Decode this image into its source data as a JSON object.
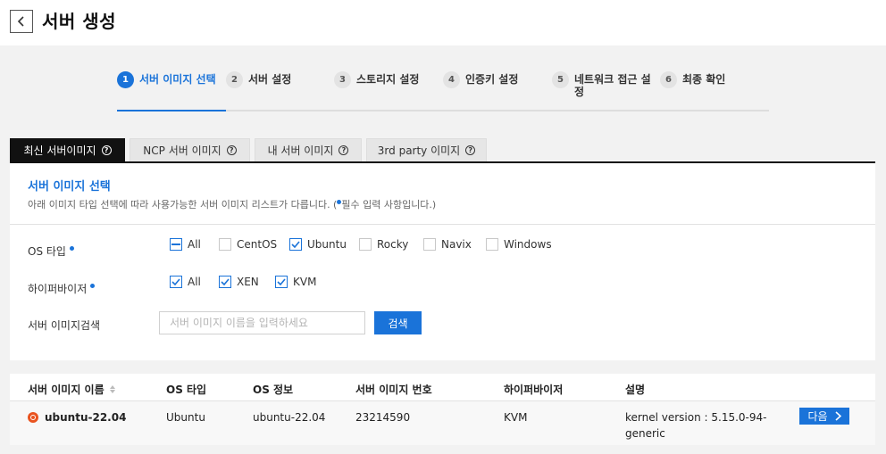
{
  "header": {
    "title": "서버 생성"
  },
  "steps": [
    {
      "num": "1",
      "label": "서버 이미지 선택",
      "active": true
    },
    {
      "num": "2",
      "label": "서버 설정"
    },
    {
      "num": "3",
      "label": "스토리지 설정"
    },
    {
      "num": "4",
      "label": "인증키 설정"
    },
    {
      "num": "5",
      "label": "네트워크 접근 설\n정"
    },
    {
      "num": "6",
      "label": "최종 확인"
    }
  ],
  "tabs": [
    {
      "label": "최신 서버이미지",
      "active": true
    },
    {
      "label": "NCP 서버 이미지"
    },
    {
      "label": "내 서버 이미지"
    },
    {
      "label": "3rd party 이미지"
    }
  ],
  "panel": {
    "title": "서버 이미지 선택",
    "desc_before": "아래 이미지 타입 선택에 따라 사용가능한 서버 이미지 리스트가 다릅니다. (",
    "desc_after": "필수 입력 사항입니다.)"
  },
  "filters": {
    "os_type": {
      "label": "OS 타입",
      "options": [
        {
          "label": "All",
          "state": "partial"
        },
        {
          "label": "CentOS",
          "state": "unchecked"
        },
        {
          "label": "Ubuntu",
          "state": "checked"
        },
        {
          "label": "Rocky",
          "state": "unchecked"
        },
        {
          "label": "Navix",
          "state": "unchecked"
        },
        {
          "label": "Windows",
          "state": "unchecked"
        }
      ]
    },
    "hypervisor": {
      "label": "하이퍼바이저",
      "options": [
        {
          "label": "All",
          "state": "checked"
        },
        {
          "label": "XEN",
          "state": "checked"
        },
        {
          "label": "KVM",
          "state": "checked"
        }
      ]
    },
    "search": {
      "label": "서버 이미지검색",
      "placeholder": "서버 이미지 이름을 입력하세요",
      "value": "",
      "button": "검색"
    }
  },
  "table": {
    "columns": [
      "서버 이미지 이름",
      "OS 타입",
      "OS 정보",
      "서버 이미지 번호",
      "하이퍼바이저",
      "설명"
    ],
    "rows": [
      {
        "name": "ubuntu-22.04",
        "os_type": "Ubuntu",
        "os_info": "ubuntu-22.04",
        "image_no": "23214590",
        "hypervisor": "KVM",
        "desc_line1": "kernel version : 5.15.0-94-",
        "desc_line2": "generic",
        "action": "다음"
      }
    ]
  },
  "colors": {
    "accent": "#1a73d9",
    "ubuntu": "#e95420"
  }
}
